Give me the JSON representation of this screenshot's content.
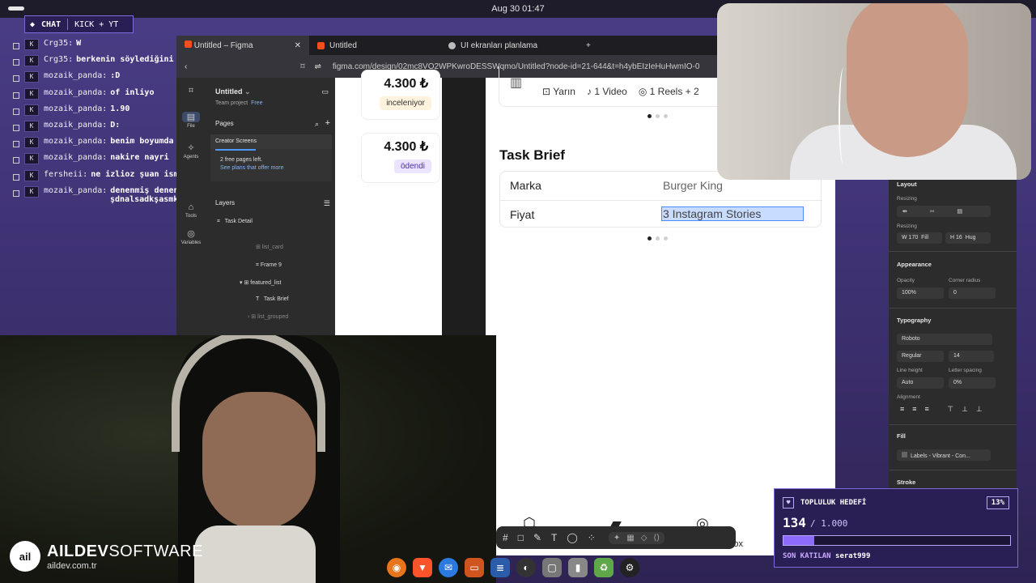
{
  "system": {
    "clock": "Aug 30  01:47"
  },
  "chat": {
    "header_label": "CHAT",
    "platforms": "KICK + YT",
    "messages": [
      {
        "user": "Crg35",
        "text": "W",
        "cont": ""
      },
      {
        "user": "Crg35",
        "text": "berkenin söylediğini mi yapıyorsun",
        "cont": ""
      },
      {
        "user": "mozaik_panda",
        "text": ":D",
        "cont": ""
      },
      {
        "user": "mozaik_panda",
        "text": "of inliyo",
        "cont": ""
      },
      {
        "user": "mozaik_panda",
        "text": "1.90",
        "cont": ""
      },
      {
        "user": "mozaik_panda",
        "text": "D:",
        "cont": ""
      },
      {
        "user": "mozaik_panda",
        "text": "benim boyumda mı",
        "cont": ""
      },
      {
        "user": "mozaik_panda",
        "text": "nakire nayri",
        "cont": ""
      },
      {
        "user": "fersheii",
        "text": "ne izlioz şuan ismi ne",
        "cont": ""
      },
      {
        "user": "mozaik_panda",
        "text": "denenmiş denenmiişş belli",
        "cont": "şdnalsadkşasmkaoapw"
      }
    ]
  },
  "browser": {
    "tabs": [
      {
        "label": "Untitled – Figma"
      },
      {
        "label": "Untitled"
      },
      {
        "label": "UI ekranları planlama"
      }
    ],
    "url": "figma.com/design/02mc8VO2WPKwroDESSWqmo/Untitled?node-id=21-644&t=h4ybEIzIeHuHwmIO-0"
  },
  "figma_left": {
    "rail": [
      {
        "label": "File",
        "icon": "file-icon"
      },
      {
        "label": "Agents",
        "icon": "agents-icon"
      },
      {
        "label": "Tools",
        "icon": "tools-icon"
      },
      {
        "label": "Variables",
        "icon": "variables-icon"
      }
    ],
    "file_title": "Untitled",
    "team": "Team project",
    "plan": "Free",
    "pages_label": "Pages",
    "active_page": "Creator Screens",
    "free_pages": "2 free pages left.",
    "see_plans": "See plans that offer more",
    "layers_label": "Layers",
    "layers": [
      "Task Detail",
      "list_card",
      "Frame 9",
      "featured_list",
      "Task Brief",
      "list_grouped"
    ]
  },
  "canvas": {
    "cards": [
      {
        "price": "4.300 ₺",
        "status": "inceleniyor"
      },
      {
        "price": "4.300 ₺",
        "status": "ödendi"
      }
    ],
    "chips": [
      "Yarın",
      "1 Video",
      "1 Reels + 2"
    ],
    "section_title": "Task Brief",
    "brief": [
      {
        "label": "Marka",
        "value": "Burger King"
      },
      {
        "label": "Fiyat",
        "value": "3 Instagram Stories"
      }
    ],
    "nav_label": "ox"
  },
  "figma_right": {
    "layout": "Layout",
    "resizing": "Resizing",
    "w": "W 170",
    "w_mode": "Fill",
    "h": "H 16",
    "h_mode": "Hug",
    "appearance": "Appearance",
    "opacity_label": "Opacity",
    "opacity": "100%",
    "radius_label": "Corner radius",
    "radius": "0",
    "typography": "Typography",
    "font": "Roboto",
    "weight": "Regular",
    "size": "14",
    "line_height_label": "Line height",
    "line_height": "Auto",
    "letter_spacing_label": "Letter spacing",
    "letter_spacing": "0%",
    "alignment": "Alignment",
    "fill": "Fill",
    "fill_value": "Labels - Vibrant - Con...",
    "stroke": "Stroke"
  },
  "movie_overlay": {
    "brand": "AILDEV",
    "brand2": "SOFTWARE",
    "site": "aildev.com.tr",
    "mark": "ail"
  },
  "goal": {
    "title": "TOPLULUK HEDEFİ",
    "percent": "13%",
    "current": "134",
    "target": "/ 1.000",
    "progress": 0.134,
    "last_label": "SON KATILAN",
    "last_user": "serat999"
  },
  "colors": {
    "accent": "#8e6bff",
    "figma_panel": "#2c2c2c",
    "selection": "#4a8cff"
  }
}
